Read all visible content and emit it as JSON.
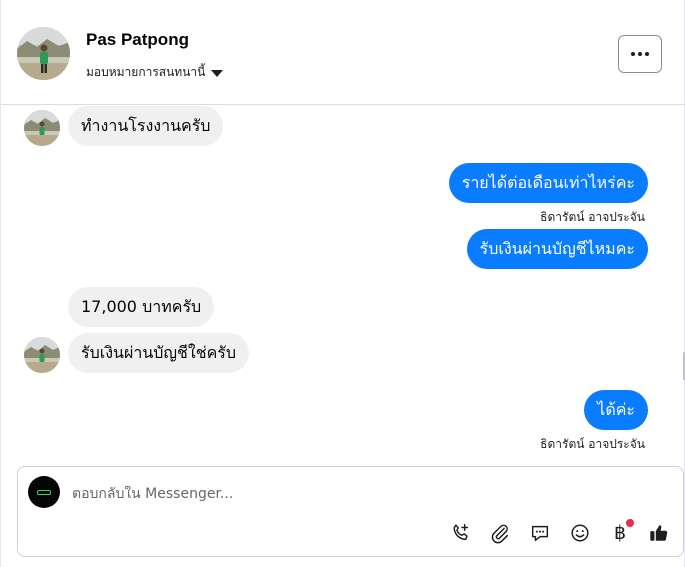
{
  "header": {
    "name": "Pas Patpong",
    "assign_label": "มอบหมายการสนทนานี้"
  },
  "messages": [
    {
      "direction": "in",
      "text": "ทำงานโรงงานครับ"
    },
    {
      "direction": "out",
      "text": "รายได้ต่อเดือนเท่าไหร่คะ",
      "sender": "ธิดารัตน์ อาจประจัน"
    },
    {
      "direction": "out",
      "text": "รับเงินผ่านบัญชีไหมคะ"
    },
    {
      "direction": "in",
      "text": "17,000 บาทครับ"
    },
    {
      "direction": "in",
      "text": "รับเงินผ่านบัญชีใช่ครับ"
    },
    {
      "direction": "out",
      "text": "ได้ค่ะ",
      "sender": "ธิดารัตน์ อาจประจัน"
    }
  ],
  "composer": {
    "placeholder": "ตอบกลับใน Messenger...",
    "baht_symbol": "฿"
  },
  "icons": [
    "phone-plus-icon",
    "paperclip-icon",
    "saved-reply-icon",
    "emoji-icon",
    "baht-icon",
    "thumbs-up-icon"
  ],
  "colors": {
    "outgoing_bubble": "#0a7cff",
    "incoming_bubble": "#f0f0f0",
    "notification_dot": "#f02849"
  }
}
